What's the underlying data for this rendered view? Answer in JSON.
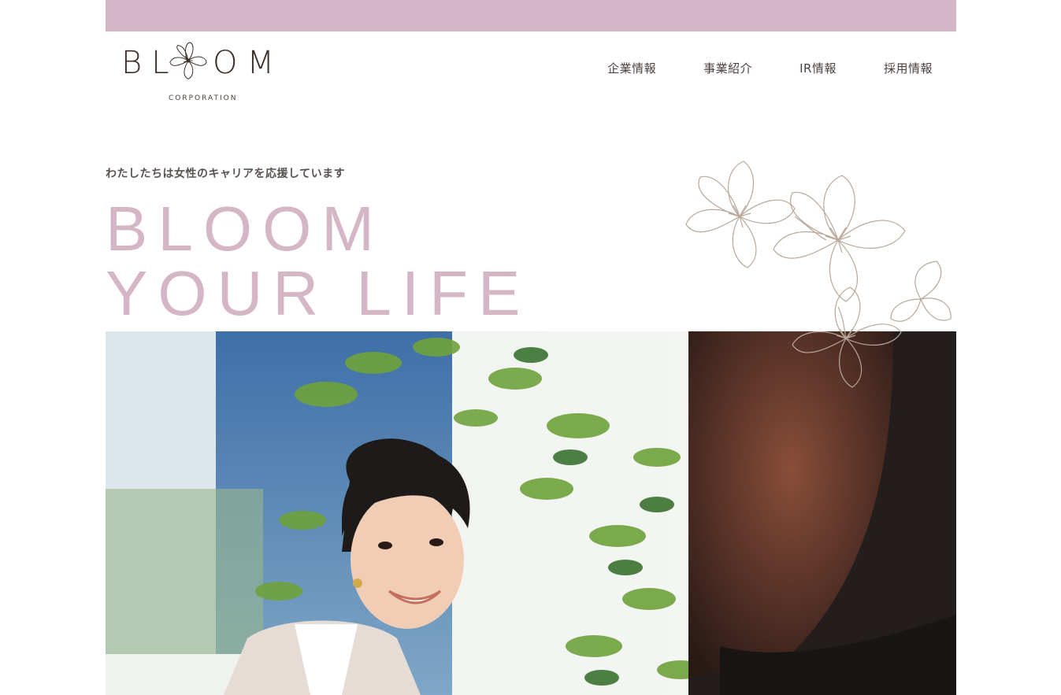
{
  "brand": {
    "logo_left": "BL",
    "logo_right": "OM",
    "logo_sub": "CORPORATION"
  },
  "nav": {
    "items": [
      {
        "label": "企業情報"
      },
      {
        "label": "事業紹介"
      },
      {
        "label": "IR情報"
      },
      {
        "label": "採用情報"
      }
    ]
  },
  "hero": {
    "tagline": "わたしたちは女性のキャリアを応援しています",
    "title_line1": "BLOOM",
    "title_line2": "YOUR LIFE"
  },
  "colors": {
    "accent": "#d5b6c6",
    "text": "#4a4240",
    "flower_outline": "#b8a89a"
  },
  "icons": {
    "logo_mark": "flower-icon",
    "decoration": "cherry-blossom-illustration"
  }
}
